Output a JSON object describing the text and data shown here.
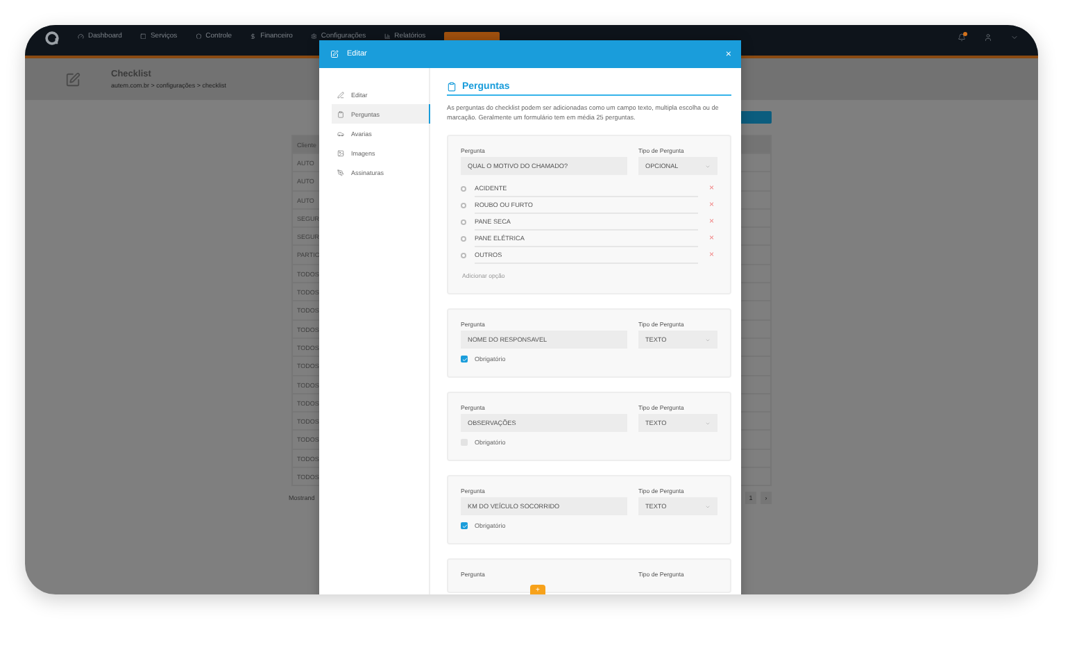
{
  "navbar": {
    "items": [
      {
        "kind": "dashboard",
        "label": "Dashboard"
      },
      {
        "kind": "services",
        "label": "Serviços"
      },
      {
        "kind": "control",
        "label": "Controle"
      },
      {
        "kind": "finance",
        "label": "Financeiro"
      },
      {
        "kind": "settings",
        "label": "Configurações"
      },
      {
        "kind": "reports",
        "label": "Relatórios"
      }
    ]
  },
  "page_header": {
    "title": "Checklist",
    "breadcrumb": "autem.com.br > configurações > checklist"
  },
  "table": {
    "columns": [
      "Cliente"
    ],
    "rows": [
      "AUTO",
      "AUTO",
      "AUTO",
      "SEGUR",
      "SEGUR",
      "PARTIC",
      "TODOS",
      "TODOS",
      "TODOS",
      "TODOS",
      "TODOS",
      "TODOS",
      "TODOS",
      "TODOS",
      "TODOS",
      "TODOS",
      "TODOS",
      "TODOS"
    ],
    "footer": "Mostrand",
    "pagination": [
      "1",
      "›"
    ]
  },
  "modal": {
    "title": "Editar",
    "close": "×",
    "sidebar": [
      {
        "kind": "edit",
        "label": "Editar",
        "selected": false
      },
      {
        "kind": "questions",
        "label": "Perguntas",
        "selected": true
      },
      {
        "kind": "damage",
        "label": "Avarias",
        "selected": false
      },
      {
        "kind": "images",
        "label": "Imagens",
        "selected": false
      },
      {
        "kind": "signatures",
        "label": "Assinaturas",
        "selected": false
      }
    ],
    "section_title": "Perguntas",
    "description": "As perguntas do checklist podem ser adicionadas como um campo texto, multipla escolha ou de marcação. Geralmente um formulário tem em média 25 perguntas.",
    "questions": [
      {
        "kind": "choice",
        "question_label": "Pergunta",
        "question": "QUAL O MOTIVO DO CHAMADO?",
        "type_label": "Tipo de Pergunta",
        "type": "OPCIONAL",
        "options": [
          {
            "label": "ACIDENTE",
            "selected": false,
            "remove": "×"
          },
          {
            "label": "ROUBO OU FURTO",
            "selected": false,
            "remove": "×"
          },
          {
            "label": "PANE SECA",
            "selected": false,
            "remove": "×"
          },
          {
            "label": "PANE ELÉTRICA",
            "selected": false,
            "remove": "×"
          },
          {
            "label": "OUTROS",
            "selected": false,
            "remove": "×"
          }
        ],
        "add_option": "Adicionar opção"
      },
      {
        "kind": "text",
        "question_label": "Pergunta",
        "question": "NOME DO RESPONSAVEL",
        "type_label": "Tipo de Pergunta",
        "type": "TEXTO",
        "required_label": "Obrigatório",
        "required": true
      },
      {
        "kind": "text",
        "question_label": "Pergunta",
        "question": "OBSERVAÇÕES",
        "type_label": "Tipo de Pergunta",
        "type": "TEXTO",
        "required_label": "Obrigatório",
        "required": false
      },
      {
        "kind": "text",
        "question_label": "Pergunta",
        "question": "KM DO VEÍCULO SOCORRIDO",
        "type_label": "Tipo de Pergunta",
        "type": "TEXTO",
        "required_label": "Obrigatório",
        "required": true
      },
      {
        "kind": "text",
        "question_label": "Pergunta",
        "type_label": "Tipo de Pergunta"
      }
    ],
    "fab": "+"
  }
}
